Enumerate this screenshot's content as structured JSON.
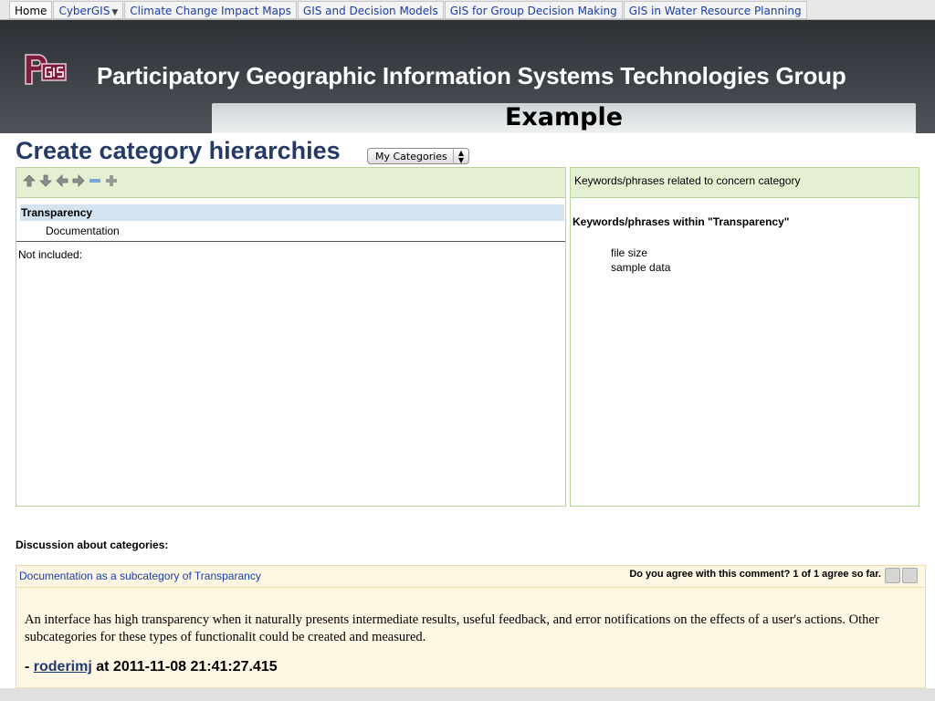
{
  "nav": {
    "home": "Home",
    "cybergis": "CyberGIS",
    "caret": "▼",
    "items": [
      "Climate Change Impact Maps",
      "GIS and Decision Models",
      "GIS for Group Decision Making",
      "GIS in Water Resource Planning"
    ]
  },
  "banner": {
    "title": "Participatory Geographic Information Systems Technologies Group",
    "example": "Example",
    "logo_color": "#7a1f3d"
  },
  "page": {
    "title": "Create category hierarchies",
    "category_select": "My Categories"
  },
  "left_panel": {
    "tools": [
      "up-arrow-icon",
      "down-arrow-icon",
      "left-arrow-icon",
      "right-arrow-icon",
      "minus-icon",
      "plus-icon"
    ],
    "tree_root": "Transparency",
    "tree_child": "Documentation",
    "not_included": "Not included:"
  },
  "right_panel": {
    "header": "Keywords/phrases related to concern category",
    "keywords_title": "Keywords/phrases within \"Transparency\"",
    "keywords": [
      "file size",
      "sample data"
    ]
  },
  "discussion": {
    "title": "Discussion about categories:",
    "subject": "Documentation as a subcategory of Transparancy",
    "agree_text": "Do you agree with this comment? 1 of 1 agree so far.",
    "body": "An interface has high transparency when it naturally presents intermediate results, useful feedback, and error notifications on the effects of a user's actions. Other subcategories for these types of functionalit could be created and measured.",
    "author_prefix": "- ",
    "author": "roderimj",
    "timestamp": " at 2011-11-08 21:41:27.415"
  },
  "colors": {
    "accent": "#253a66",
    "panel_border": "#b9d49a",
    "panel_head": "#e5f0d2",
    "comment_bg": "#fdf6e3",
    "link": "#1a3ea8"
  }
}
